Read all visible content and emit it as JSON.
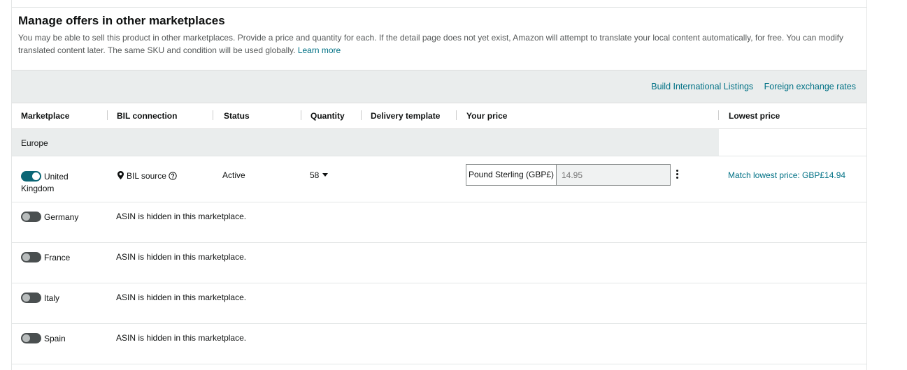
{
  "header": {
    "title": "Manage offers in other marketplaces",
    "description": "You may be able to sell this product in other marketplaces. Provide a price and quantity for each. If the detail page does not yet exist, Amazon will attempt to translate your local content automatically, for free. You can modify translated content later. The same SKU and condition will be used globally.",
    "learn_more": "Learn more"
  },
  "toolbar": {
    "build_international_listings": "Build International Listings",
    "foreign_exchange_rates": "Foreign exchange rates"
  },
  "columns": {
    "marketplace": "Marketplace",
    "bil_connection": "BIL connection",
    "status": "Status",
    "quantity": "Quantity",
    "delivery_template": "Delivery template",
    "your_price": "Your price",
    "lowest_price": "Lowest price"
  },
  "region": "Europe",
  "uk_row": {
    "marketplace": "United Kingdom",
    "enabled": true,
    "bil_connection": "BIL source",
    "status": "Active",
    "quantity": "58",
    "currency": "Pound Sterling (GBP£)",
    "price_placeholder": "14.95",
    "lowest_price_link": "Match lowest price: GBP£14.94"
  },
  "hidden_rows": [
    {
      "marketplace": "Germany",
      "enabled": false,
      "message": "ASIN is hidden in this marketplace."
    },
    {
      "marketplace": "France",
      "enabled": false,
      "message": "ASIN is hidden in this marketplace."
    },
    {
      "marketplace": "Italy",
      "enabled": false,
      "message": "ASIN is hidden in this marketplace."
    },
    {
      "marketplace": "Spain",
      "enabled": false,
      "message": "ASIN is hidden in this marketplace."
    }
  ],
  "colors": {
    "link": "#007185",
    "toggle_on": "#0b6675",
    "toggle_off": "#4a4f50",
    "band": "#eaeded"
  },
  "icons": {
    "bil_source": "location-pin-icon",
    "help": "help-circle-icon",
    "more": "kebab-menu-icon",
    "quantity": "caret-down-icon"
  }
}
